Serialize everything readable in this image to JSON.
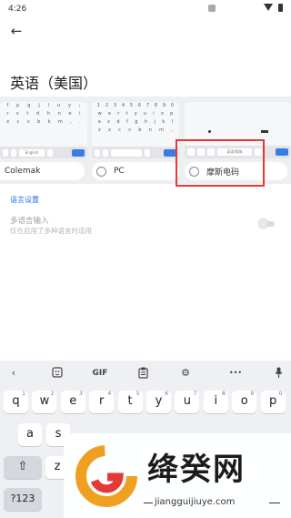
{
  "status": {
    "time": "4:26"
  },
  "page": {
    "title": "英语（美国）"
  },
  "layouts": {
    "options": [
      {
        "label": "Colemak"
      },
      {
        "label": "PC"
      },
      {
        "label": "摩斯电码"
      }
    ],
    "thumb_rows": [
      [
        "f",
        "p",
        "g",
        "j",
        "l",
        "u",
        "y",
        ";"
      ],
      [
        "r",
        "s",
        "t",
        "d",
        "h",
        "n",
        "e",
        "i"
      ],
      [
        "x",
        "c",
        "v",
        "b",
        "k",
        "m",
        ",",
        "."
      ]
    ],
    "thumb_rows_pc": [
      [
        "1",
        "2",
        "3",
        "4",
        "5",
        "6",
        "7",
        "8",
        "9",
        "0"
      ],
      [
        "w",
        "e",
        "r",
        "t",
        "y",
        "u",
        "i",
        "o",
        "p"
      ],
      [
        "a",
        "s",
        "d",
        "f",
        "g",
        "h",
        "j",
        "k",
        "l"
      ],
      [
        "z",
        "x",
        "c",
        "v",
        "b",
        "n",
        "m",
        ","
      ]
    ],
    "thumb_space_label": "English",
    "thumb_morse_space": "英语/简体"
  },
  "settings": {
    "language_settings_link": "语言设置",
    "multilingual_title": "多语言输入",
    "multilingual_sub": "仅在启用了多种语言时适用",
    "multilingual_enabled": false
  },
  "keyboard": {
    "toolbar": {
      "gif_label": "GIF",
      "more_label": "•••"
    },
    "row1": [
      {
        "k": "q",
        "n": "1"
      },
      {
        "k": "w",
        "n": "2"
      },
      {
        "k": "e",
        "n": "3"
      },
      {
        "k": "r",
        "n": "4"
      },
      {
        "k": "t",
        "n": "5"
      },
      {
        "k": "y",
        "n": "6"
      },
      {
        "k": "u",
        "n": "7"
      },
      {
        "k": "i",
        "n": "8"
      },
      {
        "k": "o",
        "n": "9"
      },
      {
        "k": "p",
        "n": "0"
      }
    ],
    "row2": [
      "a",
      "s"
    ],
    "row3": [
      "z"
    ],
    "mode_key": "?123",
    "shift_symbol": "⇧"
  },
  "watermark": {
    "text": "绛癸网",
    "url": "jiangguijiuye.com"
  }
}
